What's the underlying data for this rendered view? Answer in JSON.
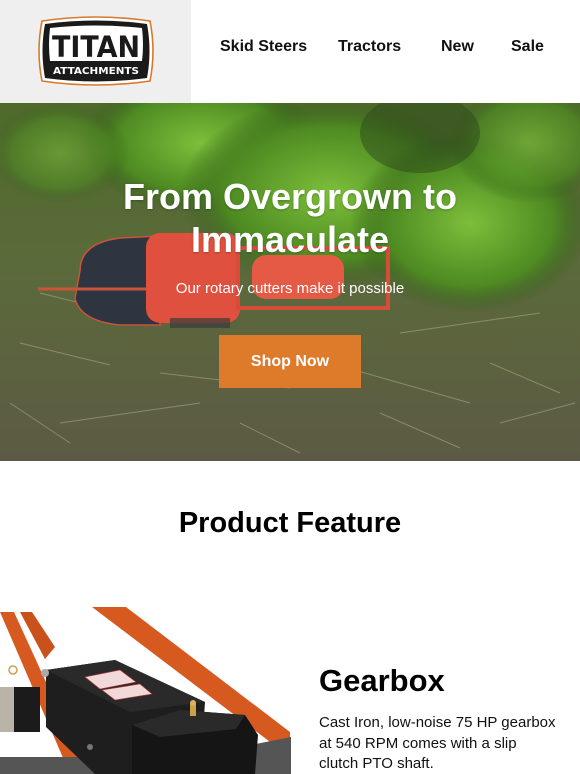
{
  "brand": {
    "logo_top": "TITAN",
    "logo_bottom": "ATTACHMENTS",
    "logo_icon": "titan-attachments-logo"
  },
  "nav": {
    "items": [
      {
        "label": "Skid Steers"
      },
      {
        "label": "Tractors"
      },
      {
        "label": "New"
      },
      {
        "label": "Sale"
      }
    ]
  },
  "hero": {
    "title": "From Overgrown to Immaculate",
    "subtitle": "Our rotary cutters make it possible",
    "cta_label": "Shop Now",
    "image": "aerial-tractor-rotary-cutter-field"
  },
  "feature_section": {
    "title": "Product Feature",
    "feature": {
      "heading": "Gearbox",
      "description": "Cast Iron, low-noise 75 HP gearbox at 540 RPM comes with a slip clutch PTO shaft.",
      "image": "rotary-cutter-gearbox-closeup"
    }
  },
  "colors": {
    "accent": "#dd7b2b",
    "logo_bg": "#efefef",
    "text": "#000000",
    "frame_orange": "#d65a1f"
  }
}
